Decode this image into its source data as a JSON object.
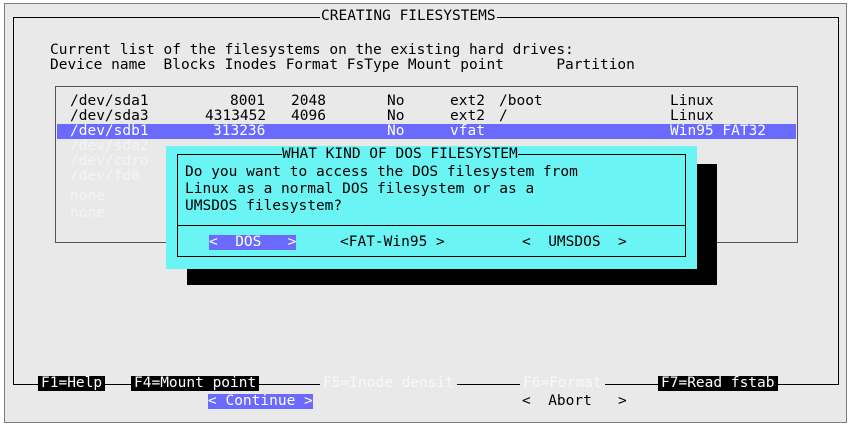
{
  "window": {
    "title": "CREATING FILESYSTEMS",
    "intro_line": "Current list of the filesystems on the existing hard drives:",
    "columns_header": "Device name  Blocks Inodes Format FsType Mount point      Partition"
  },
  "partitions": [
    {
      "device": "/dev/sda1",
      "blocks": "8001",
      "inodes": "2048",
      "format": "No",
      "fstype": "ext2",
      "mount": "/boot",
      "partition": "Linux",
      "state": "normal"
    },
    {
      "device": "/dev/sda3",
      "blocks": "4313452",
      "inodes": "4096",
      "format": "No",
      "fstype": "ext2",
      "mount": "/",
      "partition": "Linux",
      "state": "normal"
    },
    {
      "device": "/dev/sdb1",
      "blocks": "313236",
      "inodes": "",
      "format": "No",
      "fstype": "vfat",
      "mount": "",
      "partition": "Win95 FAT32",
      "state": "selected"
    },
    {
      "device": "/dev/sda2",
      "blocks": "",
      "inodes": "",
      "format": "",
      "fstype": "",
      "mount": "",
      "partition": "",
      "state": "dimmed"
    },
    {
      "device": "/dev/cdro",
      "blocks": "",
      "inodes": "",
      "format": "",
      "fstype": "",
      "mount": "",
      "partition": "",
      "state": "dimmed"
    },
    {
      "device": "/dev/fd0",
      "blocks": "",
      "inodes": "",
      "format": "",
      "fstype": "",
      "mount": "",
      "partition": "",
      "state": "dimmed"
    },
    {
      "device": "none",
      "blocks": "",
      "inodes": "",
      "format": "",
      "fstype": "",
      "mount": "",
      "partition": "",
      "state": "dimmed"
    },
    {
      "device": "none",
      "blocks": "",
      "inodes": "",
      "format": "",
      "fstype": "",
      "mount": "",
      "partition": "",
      "state": "dimmed"
    }
  ],
  "dialog": {
    "title": "WHAT KIND OF DOS FILESYSTEM",
    "lines": [
      "Do you want to access the DOS filesystem from",
      "Linux as a normal DOS filesystem or as a",
      "UMSDOS filesystem?"
    ],
    "buttons": [
      {
        "text": "<  DOS   >",
        "selected": true
      },
      {
        "text": "<FAT-Win95 >",
        "selected": false
      },
      {
        "text": "<  UMSDOS  >",
        "selected": false
      }
    ]
  },
  "function_keys": {
    "f1": "F1=Help",
    "f4": "F4=Mount point",
    "f5": "F5=Inode densit",
    "f6": "F6=Format",
    "f7": "F7=Read fstab"
  },
  "actions": {
    "continue": "< Continue >",
    "abort": "<  Abort   >"
  },
  "colors": {
    "background": "#e9e9e9",
    "selection": "#6a6aff",
    "dialog": "#6af4f4",
    "shadow": "#000000"
  }
}
